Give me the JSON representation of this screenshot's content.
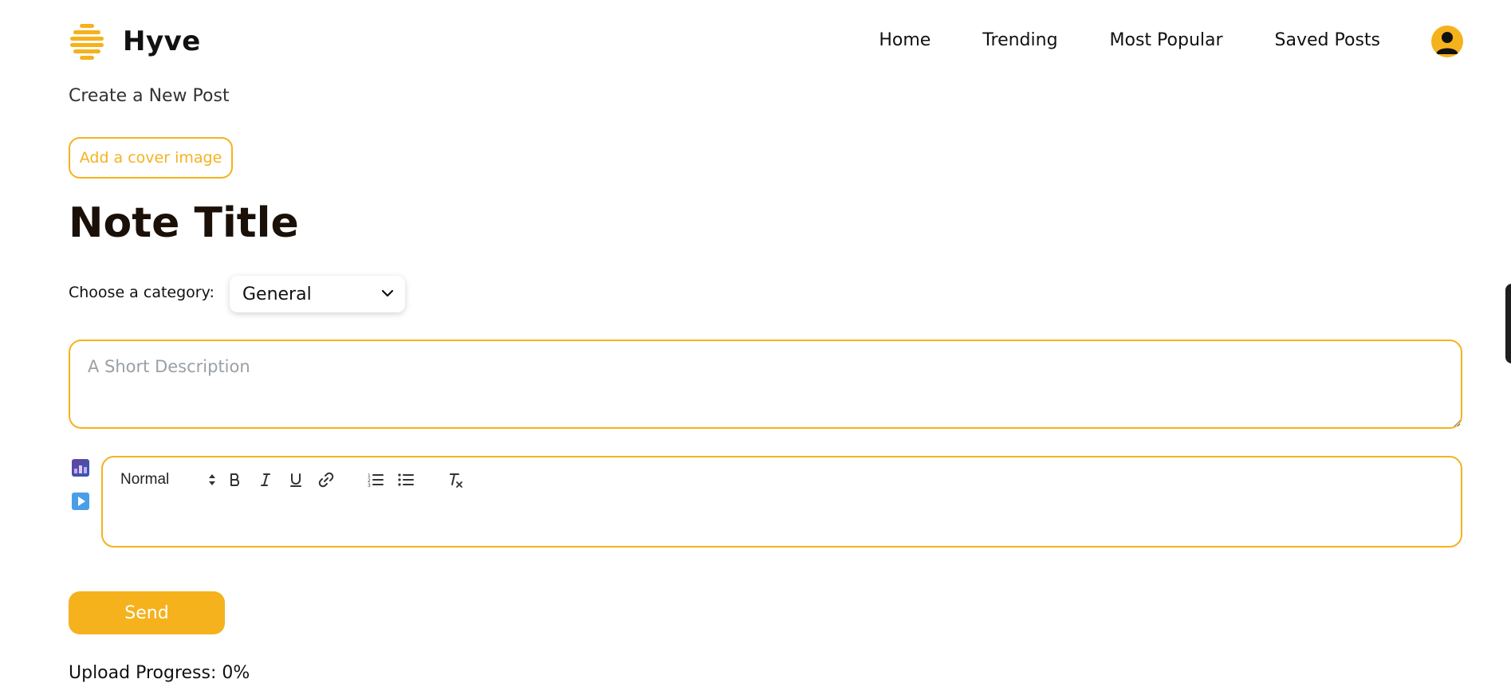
{
  "header": {
    "brand": "Hyve",
    "nav": [
      "Home",
      "Trending",
      "Most Popular",
      "Saved Posts"
    ]
  },
  "page_subtitle": "Create a New Post",
  "cover_button": "Add a cover image",
  "note_title": "Note Title",
  "category": {
    "label": "Choose a category:",
    "selected": "General"
  },
  "description": {
    "placeholder": "A Short Description",
    "value": ""
  },
  "editor": {
    "format": "Normal",
    "tools": [
      "bold",
      "italic",
      "underline",
      "link",
      "ordered-list",
      "bullet-list",
      "clean"
    ]
  },
  "send_button": "Send",
  "upload_progress": {
    "text": "Upload Progress: 0%",
    "percent": 0
  },
  "colors": {
    "accent": "#f5b21d",
    "text": "#111111",
    "placeholder": "#9aa0a6"
  }
}
